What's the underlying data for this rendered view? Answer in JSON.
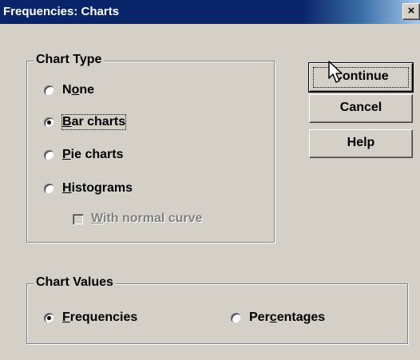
{
  "window": {
    "title": "Frequencies: Charts",
    "close_glyph": "×"
  },
  "chart_type": {
    "label": "Chart Type",
    "options": [
      {
        "label": "None",
        "mnemonic_index": 1,
        "checked": false
      },
      {
        "label": "Bar charts",
        "mnemonic_index": 0,
        "checked": true
      },
      {
        "label": "Pie charts",
        "mnemonic_index": 0,
        "checked": false
      },
      {
        "label": "Histograms",
        "mnemonic_index": 0,
        "checked": false
      }
    ],
    "normal_curve": {
      "label": "With normal curve",
      "enabled": false,
      "checked": false
    }
  },
  "chart_values": {
    "label": "Chart Values",
    "options": [
      {
        "label": "Frequencies",
        "checked": true
      },
      {
        "label": "Percentages",
        "checked": false
      }
    ]
  },
  "buttons": {
    "continue": "Continue",
    "cancel": "Cancel",
    "help": "Help"
  },
  "icons": {
    "cursor": "arrow-cursor-icon"
  },
  "colors": {
    "titlebar": "#0a246a",
    "face": "#d4d0c8"
  }
}
